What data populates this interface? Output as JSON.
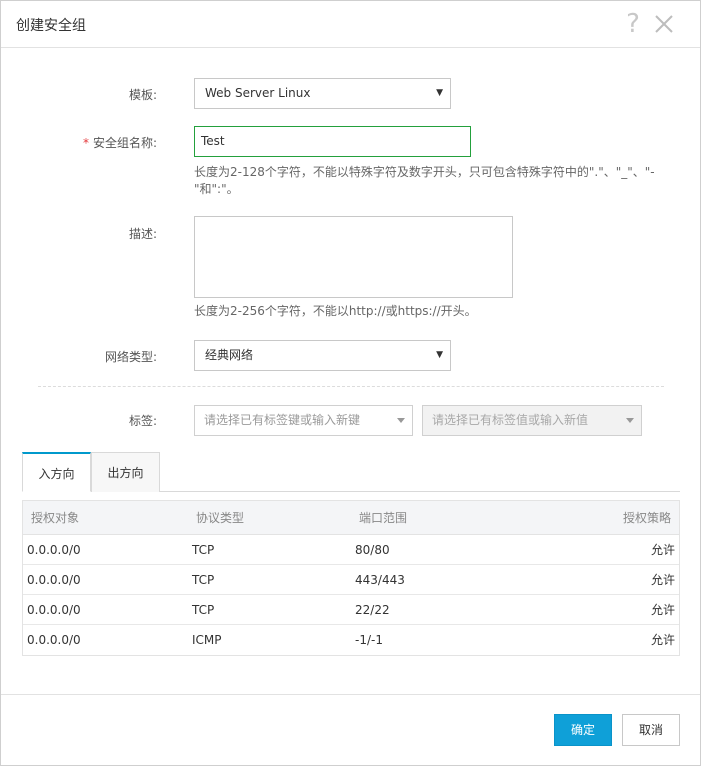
{
  "dialog": {
    "title": "创建安全组",
    "help_glyph": "?"
  },
  "form": {
    "template": {
      "label": "模板:",
      "value": "Web Server Linux"
    },
    "name": {
      "required_mark": "*",
      "label": "安全组名称:",
      "value": "Test",
      "hint_line1": "长度为2-128个字符，不能以特殊字符及数字开头，只可包含特殊字符中的\".\"、\"_\"、\"-",
      "hint_line2": "\"和\":\"。"
    },
    "description": {
      "label": "描述:",
      "value": "",
      "hint": "长度为2-256个字符，不能以http://或https://开头。"
    },
    "network_type": {
      "label": "网络类型:",
      "value": "经典网络"
    },
    "tags": {
      "label": "标签:",
      "key_placeholder": "请选择已有标签键或输入新键",
      "value_placeholder": "请选择已有标签值或输入新值"
    }
  },
  "tabs": [
    {
      "label": "入方向",
      "active": true
    },
    {
      "label": "出方向",
      "active": false
    }
  ],
  "rules_table": {
    "columns": [
      "授权对象",
      "协议类型",
      "端口范围",
      "授权策略"
    ],
    "rows": [
      {
        "object": "0.0.0.0/0",
        "protocol": "TCP",
        "ports": "80/80",
        "policy": "允许"
      },
      {
        "object": "0.0.0.0/0",
        "protocol": "TCP",
        "ports": "443/443",
        "policy": "允许"
      },
      {
        "object": "0.0.0.0/0",
        "protocol": "TCP",
        "ports": "22/22",
        "policy": "允许"
      },
      {
        "object": "0.0.0.0/0",
        "protocol": "ICMP",
        "ports": "-1/-1",
        "policy": "允许"
      }
    ]
  },
  "footer": {
    "confirm_label": "确定",
    "cancel_label": "取消"
  },
  "colors": {
    "primary": "#0fa0d8",
    "required": "#e4393c",
    "focus_border": "#23a03c",
    "tab_active": "#0099cc"
  },
  "icons": [
    "help-icon",
    "close-icon",
    "dropdown-arrow-icon",
    "caret-down-icon"
  ]
}
